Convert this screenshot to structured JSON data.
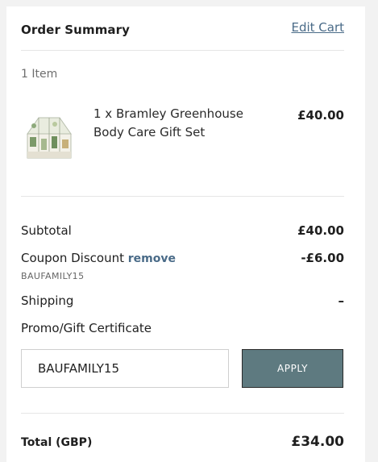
{
  "header": {
    "title": "Order Summary",
    "edit_link": "Edit Cart"
  },
  "cart": {
    "item_count": "1 Item",
    "items": [
      {
        "name": "1 x Bramley Greenhouse Body Care Gift Set",
        "price": "£40.00"
      }
    ]
  },
  "totals": {
    "subtotal_label": "Subtotal",
    "subtotal_value": "£40.00",
    "coupon_label": "Coupon Discount",
    "coupon_remove": "remove",
    "coupon_code": "BAUFAMILY15",
    "coupon_value": "-£6.00",
    "shipping_label": "Shipping",
    "shipping_value": "–",
    "promo_label": "Promo/Gift Certificate",
    "promo_input_value": "BAUFAMILY15",
    "apply_label": "APPLY",
    "total_label": "Total (GBP)",
    "total_value": "£34.00"
  },
  "colors": {
    "link": "#4a6b88",
    "apply_button": "#5e7a80"
  },
  "icons": {
    "product_thumbnail": "greenhouse-gift-box"
  }
}
